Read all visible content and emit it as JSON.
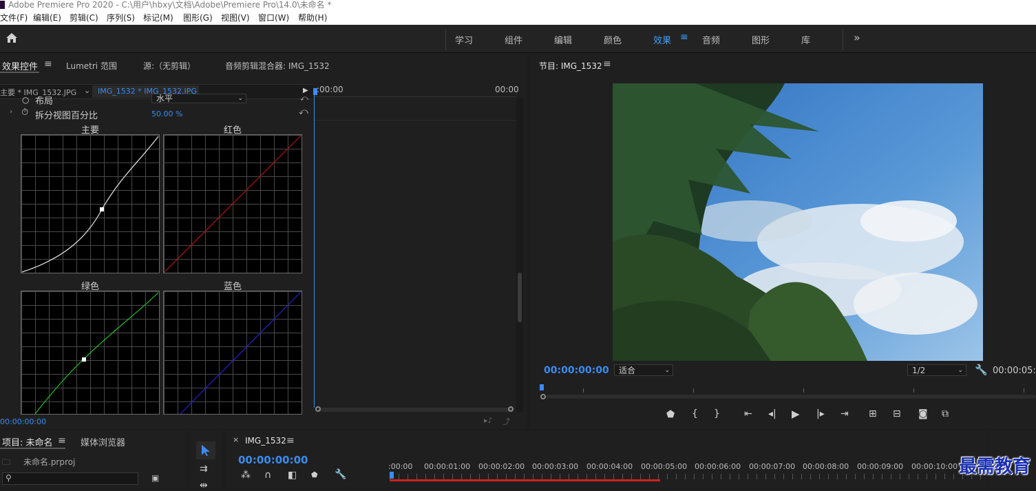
{
  "window": {
    "title": "Adobe Premiere Pro 2020 - C:\\用户\\hbxy\\文档\\Adobe\\Premiere Pro\\14.0\\未命名 *"
  },
  "menu": [
    "文件(F)",
    "编辑(E)",
    "剪辑(C)",
    "序列(S)",
    "标记(M)",
    "图形(G)",
    "视图(V)",
    "窗口(W)",
    "帮助(H)"
  ],
  "workspaces": [
    "学习",
    "组件",
    "编辑",
    "颜色",
    "效果",
    "音频",
    "图形",
    "库"
  ],
  "workspace_active": "效果",
  "effect_panel": {
    "tabs": [
      "效果控件",
      "Lumetri 范围",
      "源:（无剪辑）",
      "音频剪辑混合器: IMG_1532"
    ],
    "clip_master": "主要 * IMG_1532.JPG",
    "clip_selected": "IMG_1532 * IMG_1532.JPG",
    "time_start": ":00:00",
    "time_end": "00:00",
    "layout_label": "布局",
    "layout_value": "水平",
    "split_label": "拆分视图百分比",
    "split_value": "50.00 %",
    "curves": {
      "master": "主要",
      "red": "红色",
      "green": "绿色",
      "blue": "蓝色"
    },
    "current_time": "00:00:00:00"
  },
  "program_monitor": {
    "title": "节目: IMG_1532",
    "timecode": "00:00:00:00",
    "fit": "适合",
    "resolution": "1/2",
    "duration": "00:00:05:"
  },
  "project_panel": {
    "tabs": [
      "项目: 未命名",
      "媒体浏览器"
    ],
    "file": "未命名.prproj"
  },
  "timeline": {
    "tab": "IMG_1532",
    "timecode": "00:00:00:00",
    "ticks": [
      ":00:00",
      "00:00:01:00",
      "00:00:02:00",
      "00:00:03:00",
      "00:00:04:00",
      "00:00:05:00",
      "00:00:06:00",
      "00:00:07:00",
      "00:00:08:00",
      "00:00:09:00",
      "00:00:10:00"
    ]
  },
  "watermark": "最需教育",
  "colors": {
    "accent": "#3a8cf0",
    "panel": "#1f1f1f",
    "red_bar": "#d32020"
  }
}
